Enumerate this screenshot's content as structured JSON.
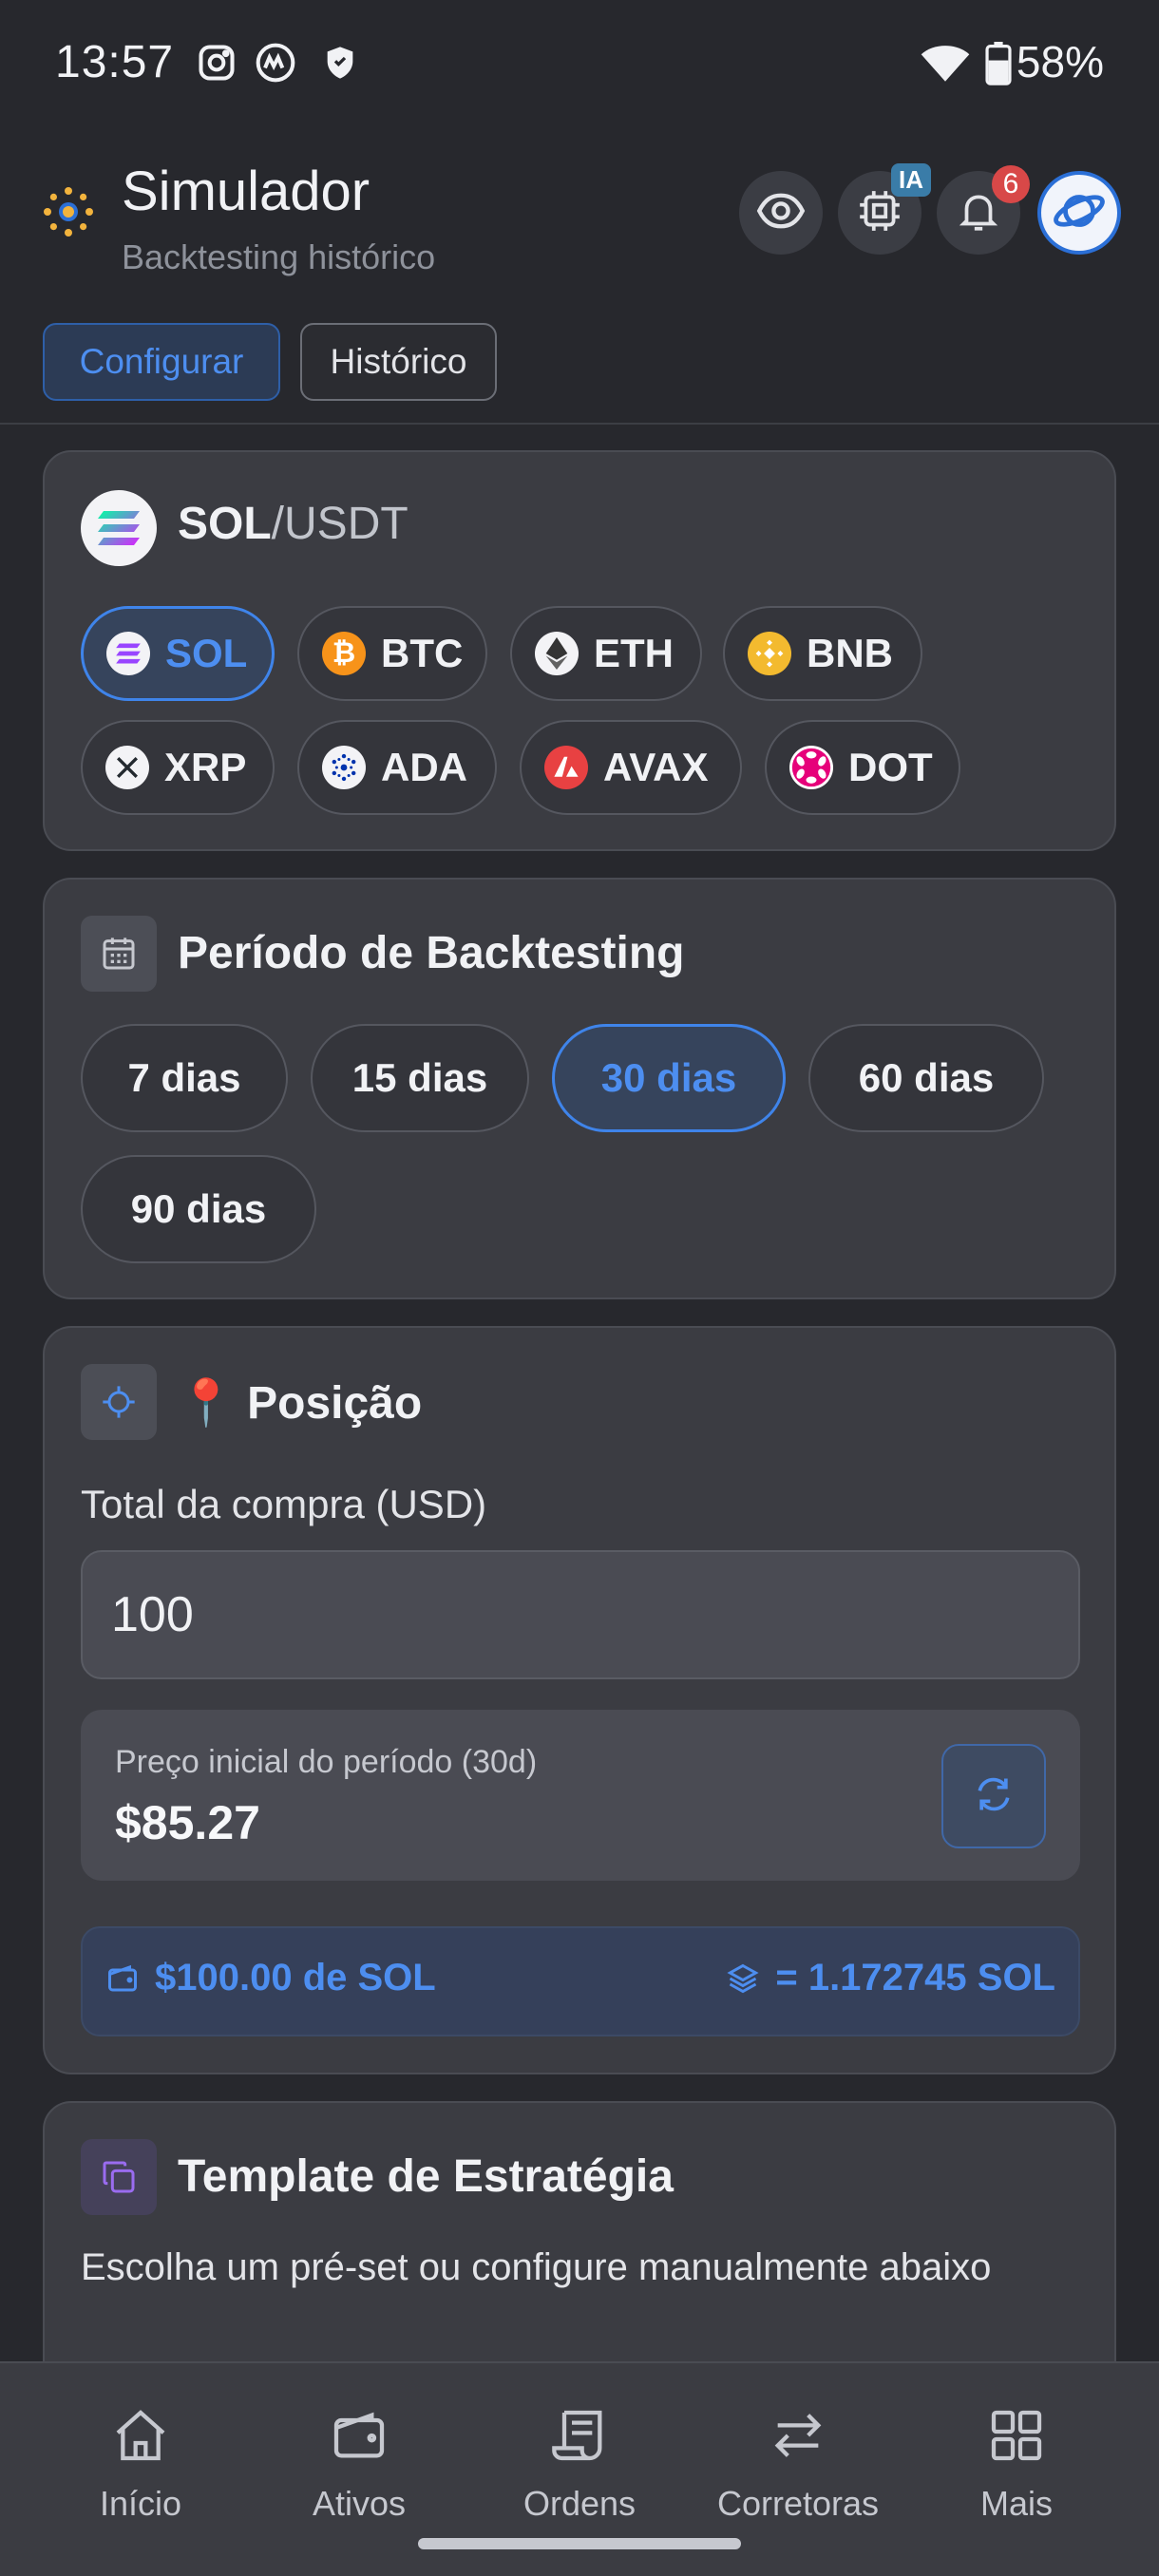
{
  "status_bar": {
    "time": "13:57",
    "battery": "58%",
    "icons": [
      "instagram-icon",
      "coinmarketcap-icon",
      "shield-icon",
      "wifi-icon",
      "battery-icon"
    ]
  },
  "header": {
    "title": "Simulador",
    "subtitle": "Backtesting histórico",
    "ai_badge": "IA",
    "notification_count": "6"
  },
  "tabs": [
    {
      "label": "Configurar",
      "active": true
    },
    {
      "label": "Histórico",
      "active": false
    }
  ],
  "pair": {
    "base": "SOL",
    "quote": "/USDT",
    "coins": [
      {
        "symbol": "SOL",
        "active": true,
        "color": "#9945ff"
      },
      {
        "symbol": "BTC",
        "active": false,
        "color": "#f7931a"
      },
      {
        "symbol": "ETH",
        "active": false,
        "color": "#627eea"
      },
      {
        "symbol": "BNB",
        "active": false,
        "color": "#f3ba2f"
      },
      {
        "symbol": "XRP",
        "active": false,
        "color": "#23292f"
      },
      {
        "symbol": "ADA",
        "active": false,
        "color": "#0033ad"
      },
      {
        "symbol": "AVAX",
        "active": false,
        "color": "#e84142"
      },
      {
        "symbol": "DOT",
        "active": false,
        "color": "#e6007a"
      }
    ]
  },
  "period": {
    "title": "Período de Backtesting",
    "options": [
      {
        "label": "7 dias",
        "active": false
      },
      {
        "label": "15 dias",
        "active": false
      },
      {
        "label": "30 dias",
        "active": true
      },
      {
        "label": "60 dias",
        "active": false
      },
      {
        "label": "90 dias",
        "active": false
      }
    ]
  },
  "position": {
    "title": "📍 Posição",
    "total_label": "Total da compra (USD)",
    "total_value": "100",
    "initial_price_label": "Preço inicial do período (30d)",
    "initial_price": "$85.27",
    "summary_amount": "$100.00 de SOL",
    "summary_qty": "= 1.172745 SOL"
  },
  "template": {
    "title": "Template de Estratégia",
    "description": "Escolha um pré-set ou configure manualmente abaixo"
  },
  "bottom_nav": [
    {
      "label": "Início",
      "icon": "home-icon"
    },
    {
      "label": "Ativos",
      "icon": "wallet-icon"
    },
    {
      "label": "Ordens",
      "icon": "receipt-icon"
    },
    {
      "label": "Corretoras",
      "icon": "swap-icon"
    },
    {
      "label": "Mais",
      "icon": "grid-icon"
    }
  ],
  "colors": {
    "accent": "#4d8ef0",
    "background": "#27282d",
    "card": "#3b3c42"
  }
}
